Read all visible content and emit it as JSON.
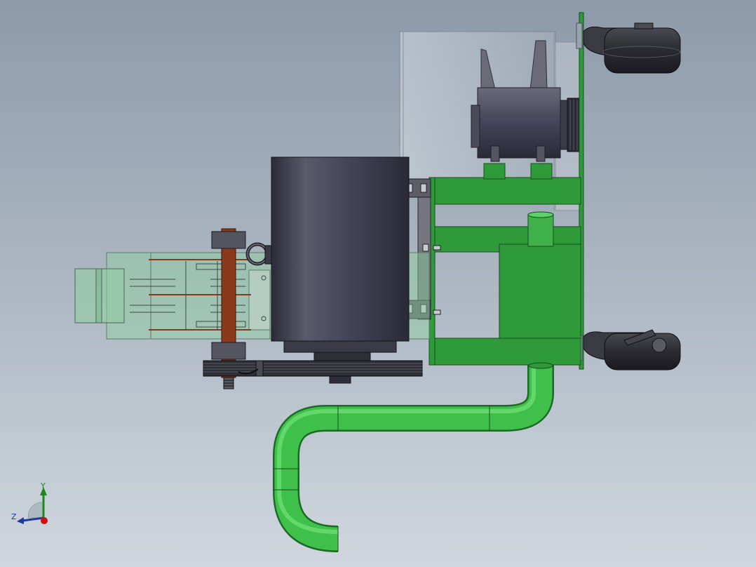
{
  "viewport": {
    "background_top": "#8d9aaa",
    "background_bottom": "#cfd6de"
  },
  "colors": {
    "green_frame": "#2f9a3a",
    "green_pipe": "#3fc04a",
    "dark_motor": "#3e3e4c",
    "translucent_cover": "#8fd0a0",
    "rubber": "#2e2e36",
    "rust": "#8a3a1a"
  },
  "triad": {
    "y_label": "Y",
    "z_label": "Z",
    "y_axis_color": "#1a8a1a",
    "z_axis_color": "#1d3a9e",
    "x_axis_color": "#d01010",
    "icon": "coordinate-triad-icon"
  }
}
